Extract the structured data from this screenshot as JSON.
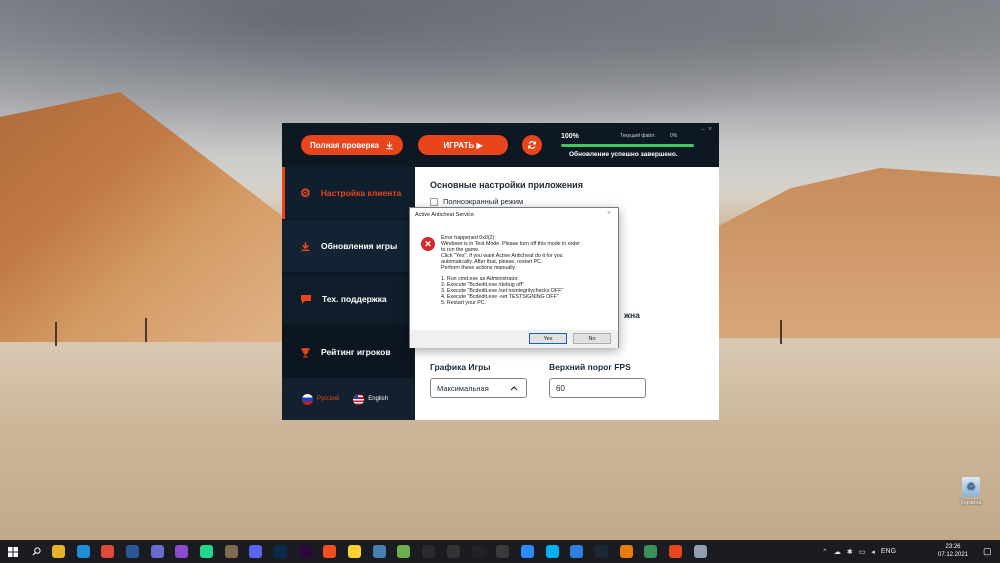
{
  "launcher": {
    "full_check_label": "Полная проверка",
    "play_label": "ИГРАТЬ ▶",
    "progress_percent_label": "100%",
    "progress_value": 1.0,
    "current_file_label": "Текущий файл:",
    "current_file_percent": "0%",
    "status_text": "Обновление успешно завершено.",
    "minimize": "−",
    "close": "×"
  },
  "sidebar": {
    "items": [
      {
        "label": "Настройка клиента",
        "icon": "gear-icon"
      },
      {
        "label": "Обновления игры",
        "icon": "download-icon"
      },
      {
        "label": "Тех. поддержка",
        "icon": "chat-icon"
      },
      {
        "label": "Рейтинг игроков",
        "icon": "trophy-icon"
      }
    ],
    "languages": [
      {
        "label": "Русский",
        "flag": "ru-flag"
      },
      {
        "label": "English",
        "flag": "us-flag"
      }
    ]
  },
  "content": {
    "title": "Основные настройки приложения",
    "fullscreen_label": "Полноэкранный режим",
    "partial_label": "жна",
    "graphics_label": "Графика Игры",
    "graphics_value": "Максимальная",
    "fps_label": "Верхний порог FPS",
    "fps_value": "60"
  },
  "dialog": {
    "title": "Active Anticheat Service",
    "message": "Error happened 0x0(2):\nWindows is in Test Mode. Please turn off this mode in order\nto run the game.\nClick \"Yes\", if you want Active Anticheat do it for you\nautomatically. After that, please, restart PC.\nPerform these actions manually:\n\n1. Run cmd.exe as Administrator.\n2. Execute \"Bcdedit.exe /debug off\"\n3. Execute \"Bcdedit.exe /set nointegritychecks OFF\"\n4. Execute \"Bcdedit.exe -set TESTSIGNING OFF\"\n5. Restart your PC.",
    "yes_label": "Yes",
    "no_label": "No",
    "close": "×"
  },
  "desktop": {
    "recycle_bin_label": "Корзина"
  },
  "taskbar": {
    "apps": [
      {
        "name": "file-explorer",
        "color": "#e8b32a"
      },
      {
        "name": "edge",
        "color": "#1f8fd6"
      },
      {
        "name": "chrome",
        "color": "#e24b3b"
      },
      {
        "name": "word",
        "color": "#2b5797"
      },
      {
        "name": "mail-m",
        "color": "#6a6ad0"
      },
      {
        "name": "visual-studio",
        "color": "#8a4bd0"
      },
      {
        "name": "pycharm",
        "color": "#21d789"
      },
      {
        "name": "gimp",
        "color": "#7d6a4f"
      },
      {
        "name": "discord",
        "color": "#5865f2"
      },
      {
        "name": "photoshop",
        "color": "#0a2a4a"
      },
      {
        "name": "premiere",
        "color": "#2a0a3a"
      },
      {
        "name": "figma",
        "color": "#f24e1e"
      },
      {
        "name": "miro",
        "color": "#ffd02f"
      },
      {
        "name": "calculator",
        "color": "#4a7fb0"
      },
      {
        "name": "notepad-plus",
        "color": "#6ab04c"
      },
      {
        "name": "terminal",
        "color": "#2b2b2b"
      },
      {
        "name": "epic-games",
        "color": "#333333"
      },
      {
        "name": "unreal",
        "color": "#222222"
      },
      {
        "name": "obs",
        "color": "#3a3a3a"
      },
      {
        "name": "zoom",
        "color": "#2d8cff"
      },
      {
        "name": "skype",
        "color": "#00aff0"
      },
      {
        "name": "dev-tool",
        "color": "#2f7fe0"
      },
      {
        "name": "steam",
        "color": "#1b2838"
      },
      {
        "name": "blender",
        "color": "#e87d0d"
      },
      {
        "name": "stats-app",
        "color": "#3a8f5a"
      },
      {
        "name": "launcher-app",
        "color": "#e8451c"
      },
      {
        "name": "window-app",
        "color": "#8fa0b0"
      }
    ],
    "lang": "ENG",
    "time": "23:26",
    "date": "07.12.2021"
  }
}
